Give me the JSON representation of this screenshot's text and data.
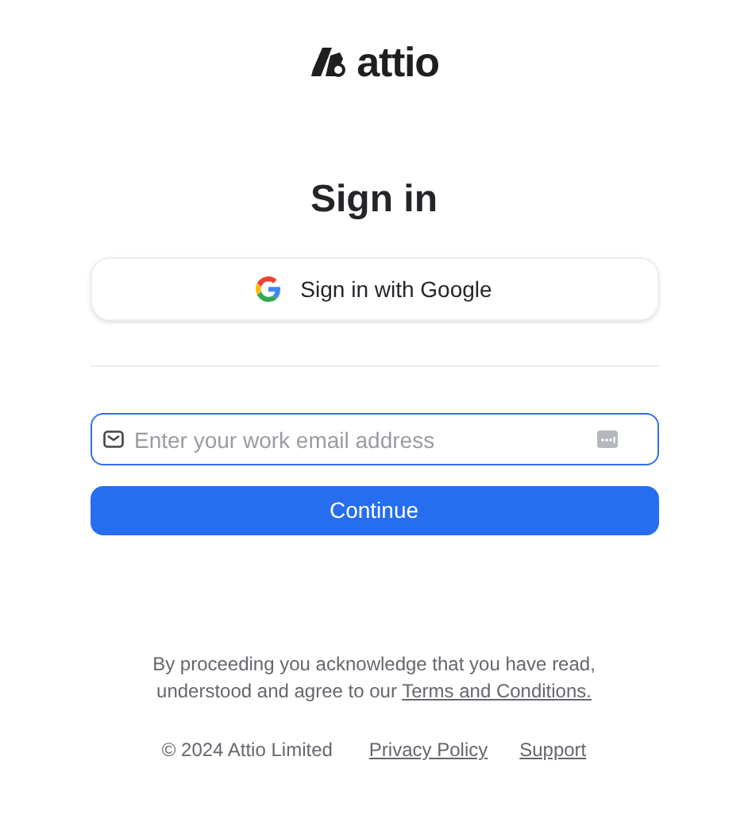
{
  "logo": {
    "wordmark": "attio"
  },
  "title": "Sign in",
  "google_button": {
    "label": "Sign in with Google"
  },
  "email_field": {
    "placeholder": "Enter your work email address",
    "focused": true
  },
  "continue_button": {
    "label": "Continue"
  },
  "legal": {
    "text": "By proceeding you acknowledge that you have read, understood and agree to our",
    "link": "Terms and Conditions."
  },
  "footer": {
    "copyright": "© 2024 Attio Limited",
    "links": [
      "Privacy Policy",
      "Support"
    ]
  }
}
